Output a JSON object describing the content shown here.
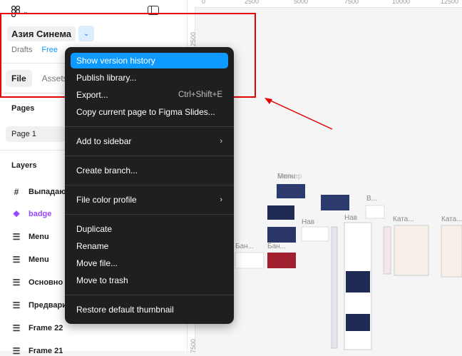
{
  "header": {
    "file_name": "Азия Синема",
    "location": "Drafts",
    "plan_badge": "Free"
  },
  "tabs": [
    {
      "label": "File"
    },
    {
      "label": "Assets"
    }
  ],
  "pages": {
    "title": "Pages",
    "items": [
      {
        "label": "Page 1"
      }
    ]
  },
  "layers": {
    "title": "Layers",
    "items": [
      {
        "label": "Выпадаю",
        "icon": "frame-icon"
      },
      {
        "label": "badge",
        "icon": "component-icon"
      },
      {
        "label": "Menu",
        "icon": "auto-layout-icon"
      },
      {
        "label": "Menu",
        "icon": "auto-layout-icon"
      },
      {
        "label": "Основно",
        "icon": "auto-layout-icon"
      },
      {
        "label": "Предвари",
        "icon": "auto-layout-icon"
      },
      {
        "label": "Frame 22",
        "icon": "auto-layout-icon"
      },
      {
        "label": "Frame 21",
        "icon": "auto-layout-icon"
      }
    ]
  },
  "menu": {
    "items": [
      {
        "label": "Show version history",
        "highlighted": true
      },
      {
        "label": "Publish library..."
      },
      {
        "label": "Export...",
        "shortcut": "Ctrl+Shift+E"
      },
      {
        "label": "Copy current page to Figma Slides..."
      },
      {
        "label": "Add to sidebar",
        "submenu": true
      },
      {
        "label": "Create branch..."
      },
      {
        "label": "File color profile",
        "submenu": true
      },
      {
        "label": "Duplicate"
      },
      {
        "label": "Rename"
      },
      {
        "label": "Move file..."
      },
      {
        "label": "Move to trash"
      },
      {
        "label": "Restore default thumbnail"
      }
    ]
  },
  "ruler": {
    "top": [
      "0",
      "2500",
      "5000",
      "7500",
      "10000",
      "12500"
    ],
    "left": [
      "2500",
      "7500"
    ]
  },
  "canvas_labels": [
    "Menu",
    "Баннер",
    "Нав",
    "В...",
    "Ката...",
    "Ката...",
    "Бан...",
    "Бан...",
    "Нав"
  ],
  "colors": {
    "highlight": "#0d99ff",
    "annotation": "#e60000",
    "menu_bg": "#1f1f1f"
  }
}
